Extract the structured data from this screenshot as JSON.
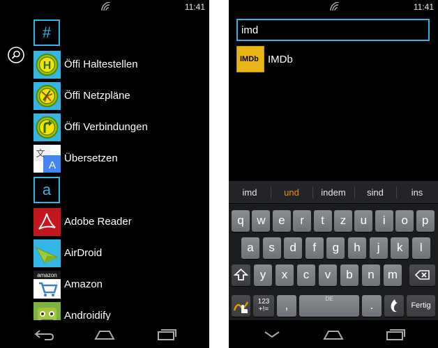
{
  "left_screen": {
    "status_time": "11:41",
    "sections": [
      {
        "header": "#",
        "apps": [
          {
            "label": "Öffi Haltestellen",
            "icon": "oeffi-haltestellen-icon"
          },
          {
            "label": "Öffi Netzpläne",
            "icon": "oeffi-netzplaene-icon"
          },
          {
            "label": "Öffi Verbindungen",
            "icon": "oeffi-verbindungen-icon"
          },
          {
            "label": "Übersetzen",
            "icon": "translate-icon"
          }
        ]
      },
      {
        "header": "a",
        "apps": [
          {
            "label": "Adobe Reader",
            "icon": "adobe-reader-icon"
          },
          {
            "label": "AirDroid",
            "icon": "airdroid-icon"
          },
          {
            "label": "Amazon",
            "icon": "amazon-icon"
          },
          {
            "label": "Androidify",
            "icon": "androidify-icon"
          }
        ]
      }
    ],
    "icon_text": {
      "haltestellen": "H",
      "uebersetzen_a": "文",
      "uebersetzen_b": "A",
      "amazon": "amazon"
    }
  },
  "right_screen": {
    "status_time": "11:41",
    "search": {
      "value": "imd"
    },
    "results": [
      {
        "label": "IMDb",
        "icon_text": "IMDb",
        "icon": "imdb-icon"
      }
    ],
    "keyboard": {
      "suggestions": [
        "imd",
        "und",
        "indem",
        "sind",
        "ins"
      ],
      "active_suggestion_index": 1,
      "row1": [
        "q",
        "w",
        "e",
        "r",
        "t",
        "z",
        "u",
        "i",
        "o",
        "p"
      ],
      "row2": [
        "a",
        "s",
        "d",
        "f",
        "g",
        "h",
        "j",
        "k",
        "l"
      ],
      "row3": [
        "y",
        "x",
        "c",
        "v",
        "b",
        "n",
        "m"
      ],
      "symbols_key": "123\n+!=",
      "comma_key": ",",
      "space_label": "DE",
      "period_key": ".",
      "done_key": "Fertig"
    }
  },
  "colors": {
    "accent": "#33b5e5",
    "suggestion_active": "#f29300",
    "background": "#000000"
  }
}
